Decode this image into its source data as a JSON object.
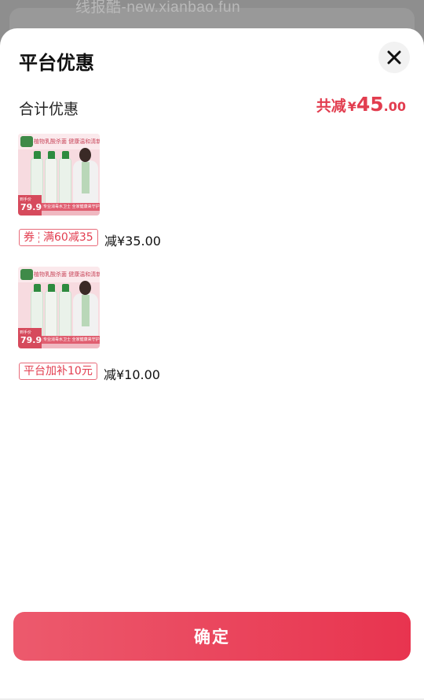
{
  "watermark": "线报酷-new.xianbao.fun",
  "sheet": {
    "title": "平台优惠",
    "close_icon": "close-icon"
  },
  "summary": {
    "label": "合计优惠",
    "prefix": "共减",
    "currency": "¥",
    "amount_int": "45",
    "amount_dec": ".00"
  },
  "items": [
    {
      "thumb": {
        "headline": "植物乳酸杀菌 健康温和清新",
        "price_label": "到手价",
        "price": "79.9",
        "footer": "专业消毒水卫士 全家健康来守护"
      },
      "tag_type": "券",
      "tag_text": "满60减35",
      "discount": "减¥35.00"
    },
    {
      "thumb": {
        "headline": "植物乳酸杀菌 健康温和清新",
        "price_label": "到手价",
        "price": "79.9",
        "footer": "专业消毒水卫士 全家健康来守护"
      },
      "tag_text": "平台加补10元",
      "discount": "减¥10.00"
    }
  ],
  "confirm_label": "确定",
  "colors": {
    "accent": "#e23d4f",
    "button_start": "#ec5a6d",
    "button_end": "#e8344f"
  }
}
